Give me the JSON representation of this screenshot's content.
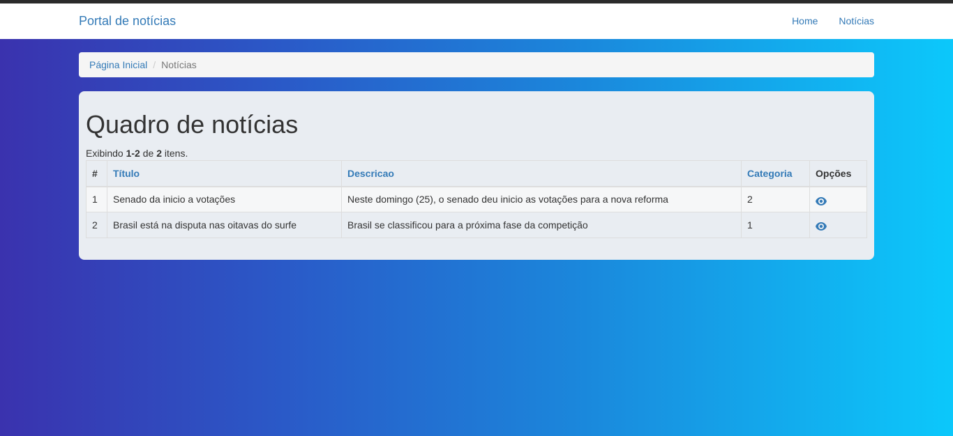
{
  "navbar": {
    "brand": "Portal de notícias",
    "links": [
      "Home",
      "Notícias"
    ]
  },
  "breadcrumb": {
    "home": "Página Inicial",
    "separator": "/",
    "current": "Notícias"
  },
  "main": {
    "title": "Quadro de notícias",
    "summary": {
      "prefix": "Exibindo ",
      "range": "1-2",
      "middle": " de ",
      "total": "2",
      "suffix": " itens."
    },
    "table": {
      "headers": [
        "#",
        "Título",
        "Descricao",
        "Categoria",
        "Opções"
      ],
      "rows": [
        {
          "num": "1",
          "titulo": "Senado da inicio a votações",
          "descricao": "Neste domingo (25), o senado deu inicio as votações para a nova reforma",
          "categoria": "2",
          "action_icon": "eye-icon"
        },
        {
          "num": "2",
          "titulo": "Brasil está na disputa nas oitavas do surfe",
          "descricao": "Brasil se classificou para a próxima fase da competição",
          "categoria": "1",
          "action_icon": "eye-icon"
        }
      ]
    }
  },
  "colors": {
    "link": "#337ab7",
    "gradient_start": "#3a32ae",
    "gradient_end": "#0cc8fb"
  }
}
